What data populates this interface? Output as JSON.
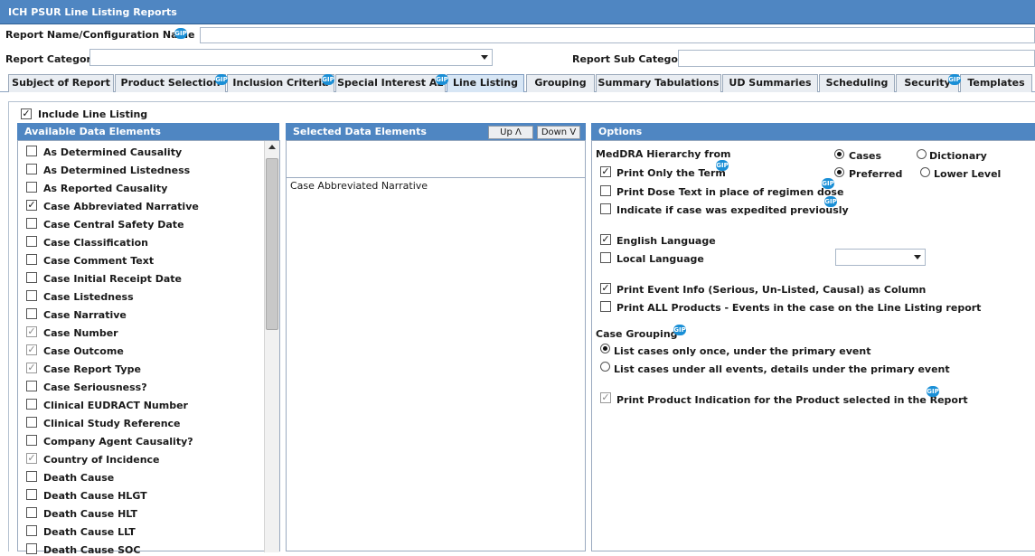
{
  "window": {
    "title": "ICH PSUR Line Listing Reports"
  },
  "header": {
    "report_name_label": "Report Name/Configuration Name",
    "report_name_value": "",
    "report_category_label": "Report Category",
    "report_category_value": "",
    "report_sub_category_label": "Report Sub Category",
    "report_sub_category_value": ""
  },
  "tabs": [
    {
      "label": "Subject of Report",
      "active": false
    },
    {
      "label": "Product Selection",
      "active": false
    },
    {
      "label": "Inclusion Criteria",
      "active": false
    },
    {
      "label": "Special Interest AE",
      "active": false
    },
    {
      "label": "Line Listing",
      "active": true
    },
    {
      "label": "Grouping",
      "active": false
    },
    {
      "label": "Summary Tabulations",
      "active": false
    },
    {
      "label": "UD Summaries",
      "active": false
    },
    {
      "label": "Scheduling",
      "active": false
    },
    {
      "label": "Security",
      "active": false
    },
    {
      "label": "Templates",
      "active": false
    }
  ],
  "include_line_listing": {
    "label": "Include Line Listing",
    "checked": true
  },
  "available": {
    "title": "Available Data Elements",
    "items": [
      {
        "label": "As Determined Causality",
        "checked": false,
        "dim": false
      },
      {
        "label": "As Determined Listedness",
        "checked": false,
        "dim": false
      },
      {
        "label": "As Reported Causality",
        "checked": false,
        "dim": false
      },
      {
        "label": "Case Abbreviated Narrative",
        "checked": true,
        "dim": false
      },
      {
        "label": "Case Central Safety Date",
        "checked": false,
        "dim": false
      },
      {
        "label": "Case Classification",
        "checked": false,
        "dim": false
      },
      {
        "label": "Case Comment Text",
        "checked": false,
        "dim": false
      },
      {
        "label": "Case Initial Receipt Date",
        "checked": false,
        "dim": false
      },
      {
        "label": "Case Listedness",
        "checked": false,
        "dim": false
      },
      {
        "label": "Case Narrative",
        "checked": false,
        "dim": false
      },
      {
        "label": "Case Number",
        "checked": true,
        "dim": true
      },
      {
        "label": "Case Outcome",
        "checked": true,
        "dim": true
      },
      {
        "label": "Case Report Type",
        "checked": true,
        "dim": true
      },
      {
        "label": "Case Seriousness?",
        "checked": false,
        "dim": false
      },
      {
        "label": "Clinical EUDRACT Number",
        "checked": false,
        "dim": false
      },
      {
        "label": "Clinical Study Reference",
        "checked": false,
        "dim": false
      },
      {
        "label": "Company Agent Causality?",
        "checked": false,
        "dim": false
      },
      {
        "label": "Country of Incidence",
        "checked": true,
        "dim": true
      },
      {
        "label": "Death Cause",
        "checked": false,
        "dim": false
      },
      {
        "label": "Death Cause HLGT",
        "checked": false,
        "dim": false
      },
      {
        "label": "Death Cause HLT",
        "checked": false,
        "dim": false
      },
      {
        "label": "Death Cause LLT",
        "checked": false,
        "dim": false
      },
      {
        "label": "Death Cause SOC",
        "checked": false,
        "dim": false
      }
    ]
  },
  "selected": {
    "title": "Selected Data Elements",
    "up_label": "Up Λ",
    "down_label": "Down V",
    "items": [
      "Case Abbreviated Narrative"
    ]
  },
  "options": {
    "title": "Options",
    "meddra_label": "MedDRA Hierarchy from",
    "cases_label": "Cases",
    "dictionary_label": "Dictionary",
    "preferred_label": "Preferred",
    "lower_level_label": "Lower Level",
    "print_only_term": "Print Only the Term",
    "print_dose_text": "Print Dose Text in place of regimen dose",
    "indicate_expedited": "Indicate if case was expedited previously",
    "english_language": "English Language",
    "local_language": "Local Language",
    "local_language_value": "",
    "print_event_info": "Print Event Info (Serious, Un-Listed, Causal) as Column",
    "print_all_products": "Print ALL Products - Events in the case on the Line Listing report",
    "case_grouping_label": "Case Grouping",
    "list_once": "List cases only once, under the primary event",
    "list_all": "List cases under all events, details under the primary event",
    "print_product_indication": "Print Product Indication for the Product selected in the Report"
  },
  "colors": {
    "accent": "#4f86c2",
    "badge": "#1a8fd6"
  },
  "icons": {
    "help_badge": "gip-icon",
    "check": "check-icon"
  }
}
